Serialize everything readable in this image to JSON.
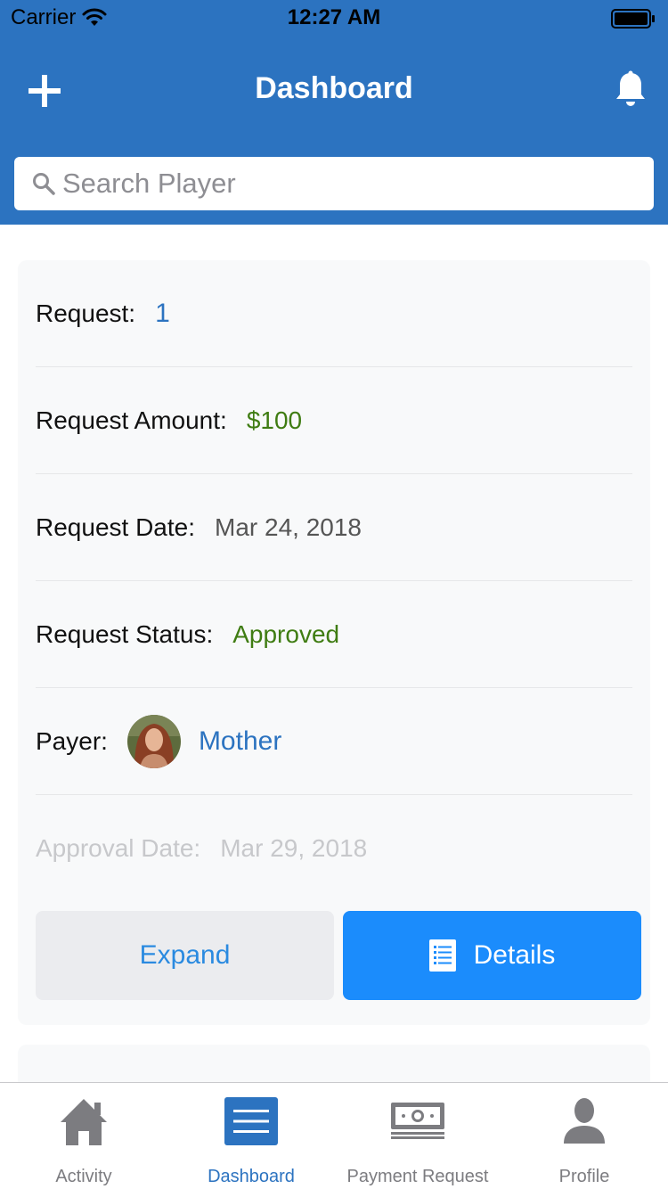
{
  "status_bar": {
    "carrier": "Carrier",
    "time": "12:27 AM"
  },
  "header": {
    "title": "Dashboard",
    "add_icon": "plus-icon",
    "bell_icon": "bell-icon",
    "color": "#2c73c0"
  },
  "search": {
    "placeholder": "Search Player",
    "value": ""
  },
  "request_card": {
    "request_label": "Request:",
    "request_value": "1",
    "amount_label": "Request Amount:",
    "amount_value": "$100",
    "date_label": "Request Date:",
    "date_value": "Mar 24, 2018",
    "status_label": "Request Status:",
    "status_value": "Approved",
    "payer_label": "Payer:",
    "payer_name": "Mother",
    "approval_label": "Approval Date:",
    "approval_value": "Mar 29, 2018",
    "expand_label": "Expand",
    "details_label": "Details"
  },
  "tabbar": {
    "tabs": [
      {
        "label": "Activity",
        "icon": "home-icon",
        "active": false
      },
      {
        "label": "Dashboard",
        "icon": "list-icon",
        "active": true
      },
      {
        "label": "Payment Request",
        "icon": "banknote-icon",
        "active": false
      },
      {
        "label": "Profile",
        "icon": "person-icon",
        "active": false
      }
    ]
  },
  "colors": {
    "primary": "#2c73c0",
    "accent_button": "#1b8cfc",
    "success": "#3f7c12"
  }
}
